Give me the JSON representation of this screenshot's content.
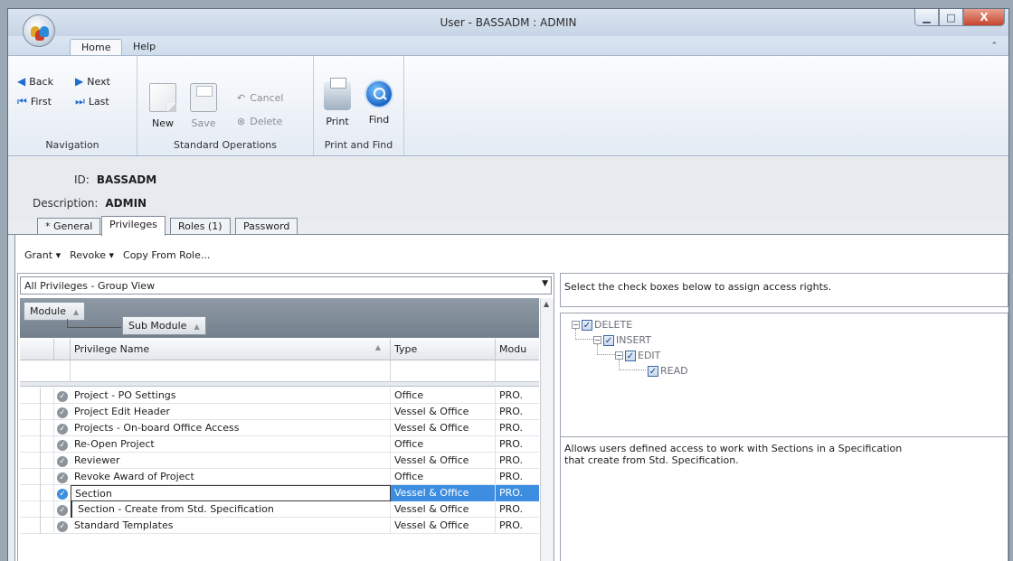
{
  "window": {
    "title": "User - BASSADM : ADMIN",
    "controls": {
      "minimize": "▁",
      "maximize": "□",
      "close": "X"
    }
  },
  "ribbon_tabs": [
    {
      "label": "Home",
      "active": true
    },
    {
      "label": "Help",
      "active": false
    }
  ],
  "ribbon": {
    "navigation": {
      "back": "Back",
      "next": "Next",
      "first": "First",
      "last": "Last",
      "label": "Navigation"
    },
    "standard_operations": {
      "new": "New",
      "save": "Save",
      "cancel": "Cancel",
      "delete": "Delete",
      "label": "Standard Operations"
    },
    "print_find": {
      "print": "Print",
      "find": "Find",
      "label": "Print and Find"
    }
  },
  "info": {
    "id_label": "ID:",
    "id_value": "BASSADM",
    "desc_label": "Description:",
    "desc_value": "ADMIN"
  },
  "detail_tabs": [
    {
      "label": "* General",
      "active": false
    },
    {
      "label": "Privileges",
      "active": true
    },
    {
      "label": "Roles (1)",
      "active": false
    },
    {
      "label": "Password",
      "active": false
    }
  ],
  "privileges_toolbar": {
    "grant": "Grant ▾",
    "revoke": "Revoke ▾",
    "copy": "Copy From Role..."
  },
  "view_select": "All Privileges - Group View",
  "group_by": {
    "module": "Module",
    "sub_module": "Sub Module"
  },
  "columns": {
    "name": "Privilege Name",
    "type": "Type",
    "module": "Modu"
  },
  "rows": [
    {
      "name": "Project - PO Settings",
      "type": "Office",
      "module": "PRO."
    },
    {
      "name": "Project Edit Header",
      "type": "Vessel & Office",
      "module": "PRO."
    },
    {
      "name": "Projects - On-board Office Access",
      "type": "Vessel & Office",
      "module": "PRO."
    },
    {
      "name": "Re-Open Project",
      "type": "Office",
      "module": "PRO."
    },
    {
      "name": "Reviewer",
      "type": "Vessel & Office",
      "module": "PRO."
    },
    {
      "name": "Revoke Award of Project",
      "type": "Office",
      "module": "PRO."
    },
    {
      "name": "Section",
      "type": "Vessel & Office",
      "module": "PRO."
    },
    {
      "name": "Section - Create from Std. Specification",
      "type": "Vessel & Office",
      "module": "PRO."
    },
    {
      "name": "Standard Templates",
      "type": "Vessel & Office",
      "module": "PRO."
    }
  ],
  "right_panel": {
    "instructions": "Select the check boxes below to assign access rights.",
    "tree": [
      "DELETE",
      "INSERT",
      "EDIT",
      "READ"
    ],
    "description_line1": "Allows users defined access to work with Sections in a Specification",
    "description_line2": "that create from Std. Specification."
  },
  "colors": {
    "selection": "#3d8ee0",
    "accent": "#1f6dcc"
  }
}
